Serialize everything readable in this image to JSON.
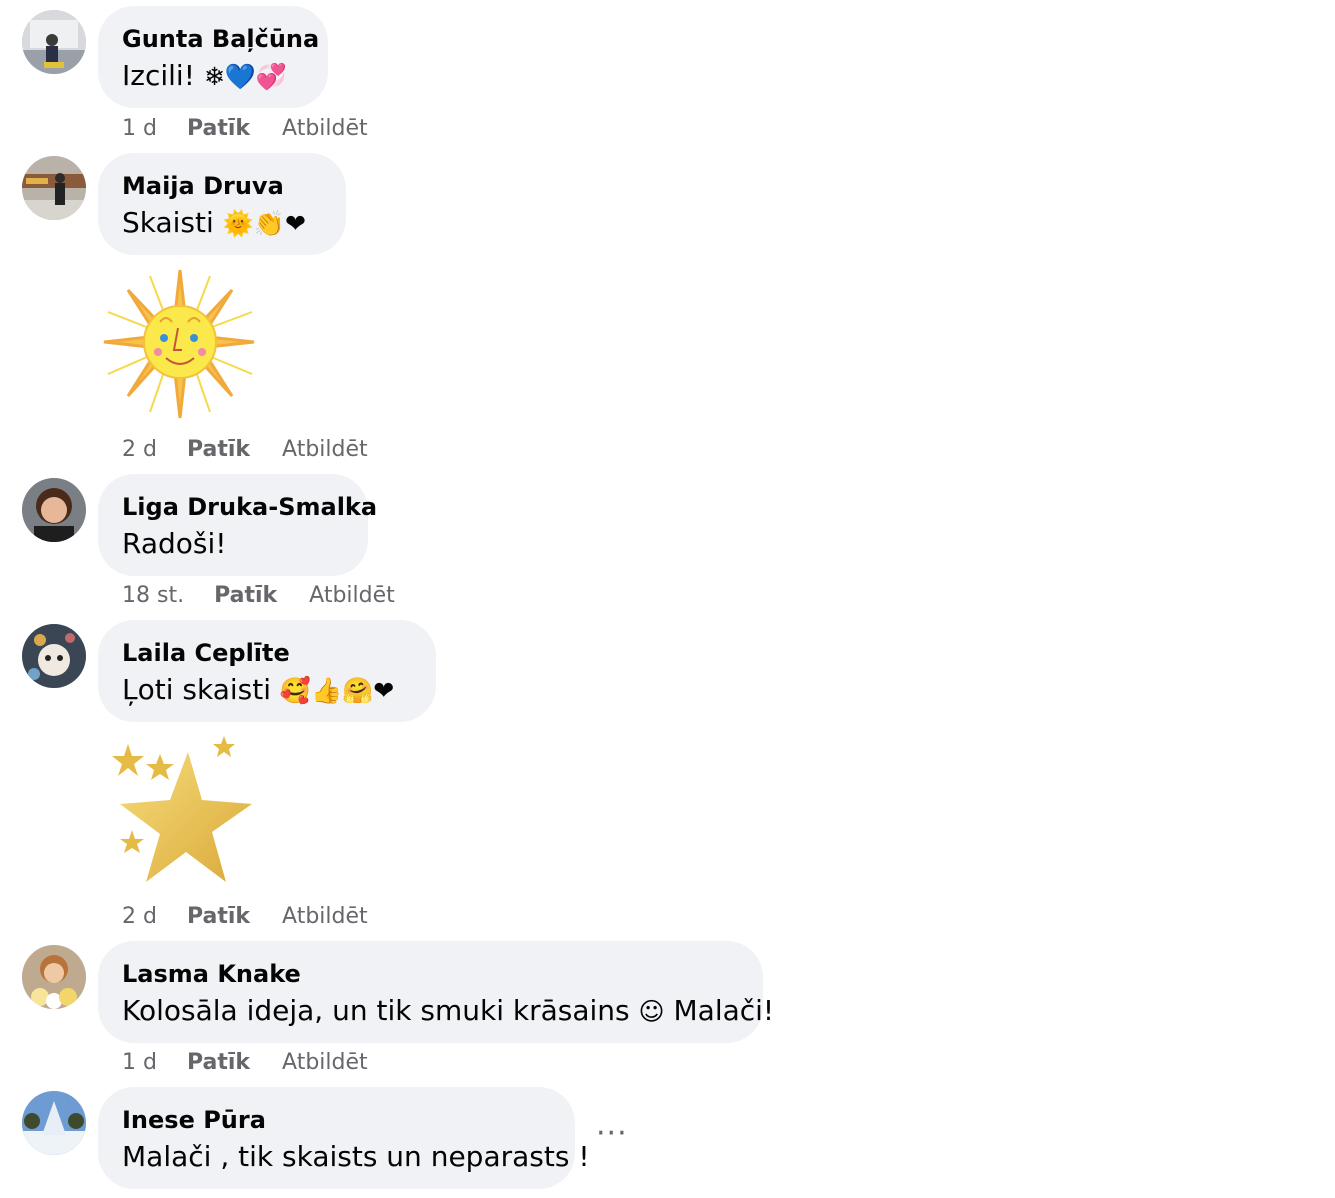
{
  "comments": [
    {
      "author": "Gunta Baļčūna",
      "text": "Izcili!",
      "emoji": "❄💙💞",
      "time": "1 d",
      "like": "Patīk",
      "reply": "Atbildēt"
    },
    {
      "author": "Maija Druva",
      "text": "Skaisti",
      "emoji": "🌞👏❤",
      "time": "2 d",
      "like": "Patīk",
      "reply": "Atbildēt"
    },
    {
      "author": "Liga Druka-Smalka",
      "text": "Radoši!",
      "emoji": "",
      "time": "18 st.",
      "like": "Patīk",
      "reply": "Atbildēt"
    },
    {
      "author": "Laila Ceplīte",
      "text": "Ļoti skaisti",
      "emoji": "🥰👍🤗❤",
      "time": "2 d",
      "like": "Patīk",
      "reply": "Atbildēt"
    },
    {
      "author": "Lasma Knake",
      "text": "Kolosāla ideja, un tik smuki krāsains",
      "emoji": "☺",
      "text2": "Malači!",
      "time": "1 d",
      "like": "Patīk",
      "reply": "Atbildēt"
    },
    {
      "author": "Inese Pūra",
      "text": "Malači , tik skaists un neparasts !",
      "emoji": ""
    }
  ],
  "more_icon": "···",
  "stickers": [
    "sun-sticker",
    "stars-sticker"
  ],
  "colors": {
    "bubble": "#f0f2f5",
    "meta": "#65676b",
    "text": "#050505"
  }
}
